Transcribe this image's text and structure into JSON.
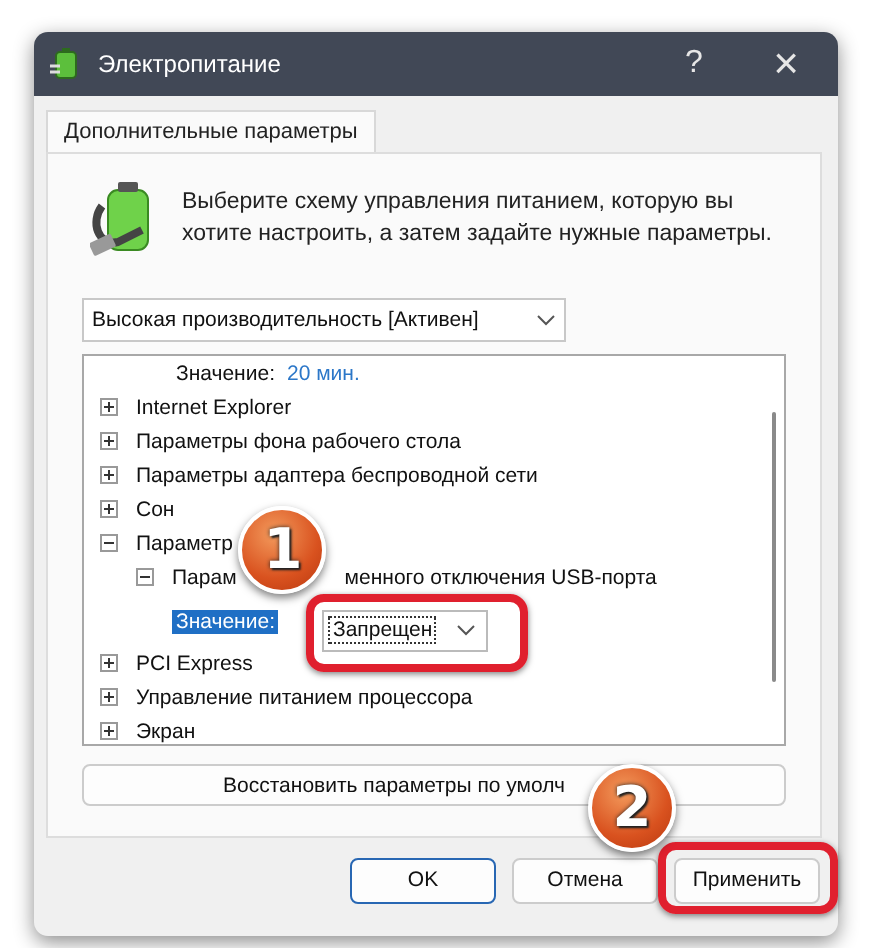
{
  "window": {
    "title": "Электропитание",
    "help": "?",
    "close": "×"
  },
  "tabs": [
    {
      "label": "Дополнительные параметры",
      "selected": true
    }
  ],
  "intro": "Выберите схему управления питанием, которую вы хотите настроить, а затем задайте нужные параметры.",
  "plan_select": {
    "value": "Высокая производительность [Активен]"
  },
  "tree": {
    "items": [
      {
        "children": [
          {
            "children": [
              {
                "kind": "value",
                "label": "Значение:",
                "value": "20 мин.",
                "selected": false
              }
            ]
          }
        ]
      },
      {
        "kind": "node",
        "label": "Internet Explorer",
        "expanded": false
      },
      {
        "kind": "node",
        "label": "Параметры фона рабочего стола",
        "expanded": false
      },
      {
        "kind": "node",
        "label": "Параметры адаптера беспроводной сети",
        "expanded": false
      },
      {
        "kind": "node",
        "label": "Сон",
        "expanded": false
      },
      {
        "kind": "node",
        "label": "Параметр",
        "expanded": true,
        "children": [
          {
            "kind": "node",
            "label": "Парам",
            "label_after_badge": "менного отключения USB-порта",
            "expanded": true,
            "children": [
              {
                "kind": "choice",
                "label": "Значение:",
                "value": "Запрещен",
                "selected": true,
                "badge": "1",
                "highlighted": true
              }
            ]
          }
        ]
      },
      {
        "kind": "node",
        "label": "PCI Express",
        "expanded": false
      },
      {
        "kind": "node",
        "label": "Управление питанием процессора",
        "expanded": false
      },
      {
        "kind": "node",
        "label": "Экран",
        "expanded": false
      }
    ]
  },
  "restore_button": "Восстановить параметры по умолч",
  "buttons": [
    {
      "label": "OK",
      "kind": "default"
    },
    {
      "label": "Отмена",
      "kind": "normal"
    },
    {
      "label": "Применить",
      "kind": "normal",
      "badge": "2",
      "highlighted": true
    }
  ]
}
